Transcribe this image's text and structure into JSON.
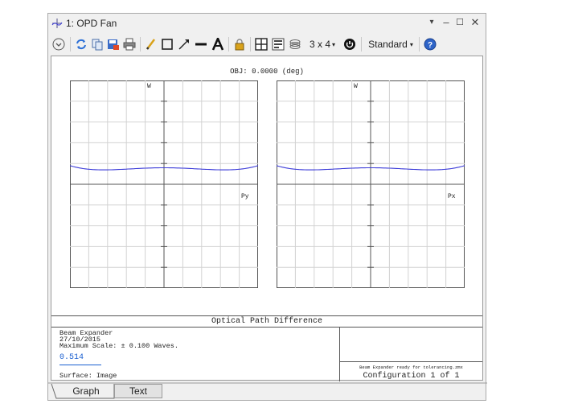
{
  "window": {
    "title": "1: OPD Fan"
  },
  "toolbar": {
    "layout_label": "3 x 4",
    "style_label": "Standard"
  },
  "graph": {
    "obj_label": "OBJ: 0.0000 (deg)",
    "left_plot": {
      "y_label": "W",
      "x_label": "Py"
    },
    "right_plot": {
      "y_label": "W",
      "x_label": "Px"
    },
    "caption": "Optical Path Difference"
  },
  "info": {
    "line1": "Beam Expander",
    "line2": "27/10/2015",
    "line3": "Maximum Scale: ± 0.100 Waves.",
    "scale_value": "0.514",
    "surface": "Surface: Image",
    "file_note": "Beam Expander ready for tolerancing.zmx",
    "configuration": "Configuration 1 of 1"
  },
  "tabs": [
    {
      "label": "Graph"
    },
    {
      "label": "Text"
    }
  ],
  "colors": {
    "curve": "#3a3ad8",
    "accent_blue": "#1a5fd0"
  }
}
